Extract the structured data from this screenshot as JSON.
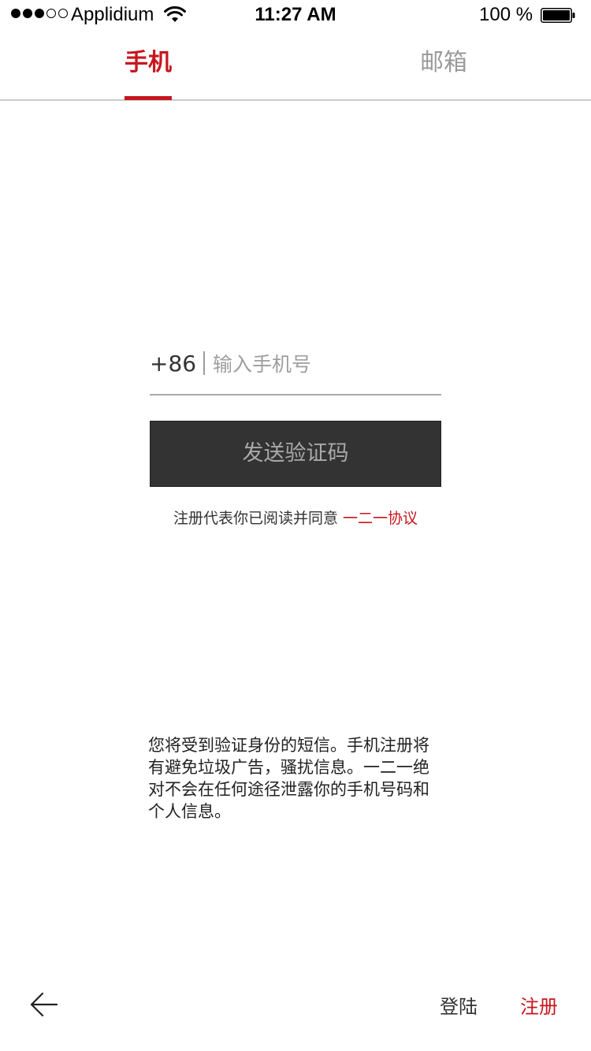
{
  "status_bar": {
    "carrier": "Applidium",
    "time": "11:27 AM",
    "battery_percent": "100 %",
    "signal_bars_filled": 3,
    "signal_bars_total": 5
  },
  "tabs": [
    {
      "label": "手机",
      "active": true
    },
    {
      "label": "邮箱",
      "active": false
    }
  ],
  "phone_form": {
    "country_code": "+86",
    "phone_placeholder": "输入手机号",
    "phone_value": "",
    "send_button_label": "发送验证码"
  },
  "agreement": {
    "text": "注册代表你已阅读并同意",
    "link_label": "一二一协议"
  },
  "notice": "您将受到验证身份的短信。手机注册将有避免垃圾广告，骚扰信息。一二一绝对不会在任何途径泄露你的手机号码和个人信息。",
  "footer": {
    "login_label": "登陆",
    "register_label": "注册"
  },
  "colors": {
    "accent": "#c8161e",
    "button_bg": "#333333",
    "button_text": "#a9a9a9",
    "inactive_tab": "#9a9a9a"
  },
  "icons": {
    "back": "arrow-left-icon",
    "wifi": "wifi-icon",
    "battery": "battery-icon"
  }
}
